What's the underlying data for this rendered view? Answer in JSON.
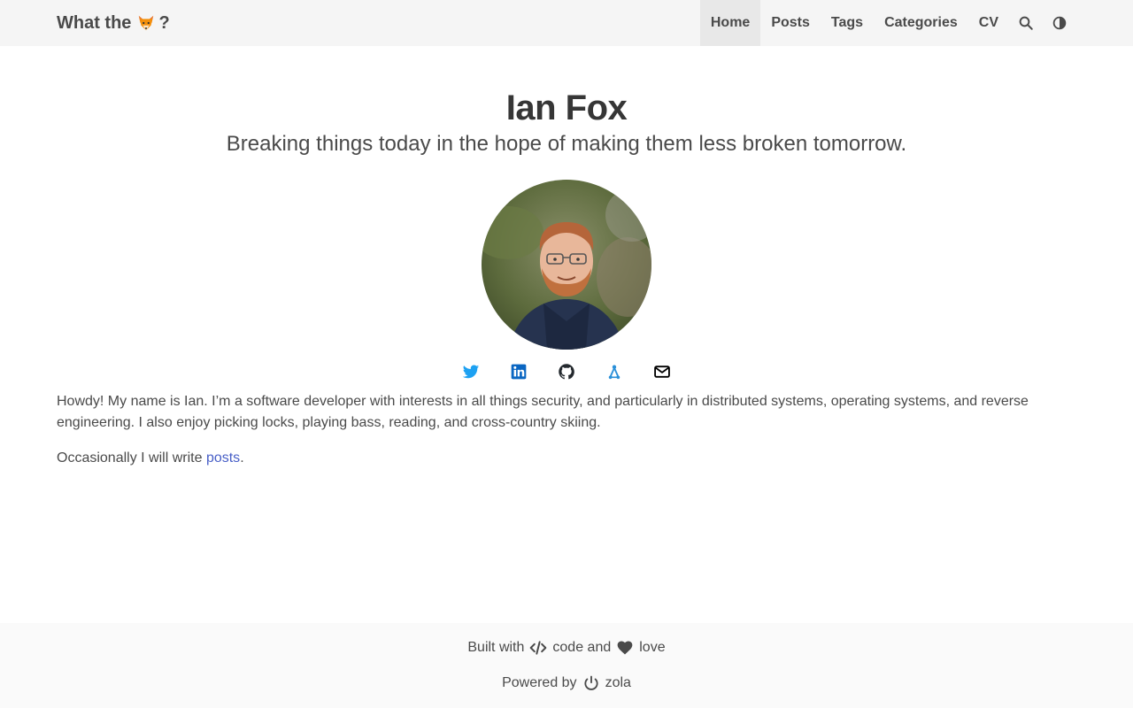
{
  "navbar": {
    "brand_prefix": "What the",
    "brand_suffix": "?",
    "items": [
      {
        "label": "Home",
        "active": true
      },
      {
        "label": "Posts",
        "active": false
      },
      {
        "label": "Tags",
        "active": false
      },
      {
        "label": "Categories",
        "active": false
      },
      {
        "label": "CV",
        "active": false
      }
    ],
    "icons": [
      "search-icon",
      "theme-toggle-icon"
    ]
  },
  "hero": {
    "title": "Ian Fox",
    "subtitle": "Breaking things today in the hope of making them less broken tomorrow."
  },
  "socials": [
    {
      "name": "twitter-icon",
      "color": "#1da1f2"
    },
    {
      "name": "linkedin-icon",
      "color": "#0a66c2"
    },
    {
      "name": "github-icon",
      "color": "#24292e"
    },
    {
      "name": "mastodon-icon",
      "color": "#2b90d9"
    },
    {
      "name": "email-icon",
      "color": "#000000"
    }
  ],
  "content": {
    "intro": "Howdy! My name is Ian. I’m a software developer with interests in all things security, and particularly in distributed systems, operating systems, and reverse engineering. I also enjoy picking locks, playing bass, reading, and cross-country skiing.",
    "occasionally_prefix": "Occasionally I will write",
    "posts_link": "posts",
    "occasionally_suffix": "."
  },
  "footer": {
    "built_with": "Built with",
    "code": "code and",
    "love": "love",
    "powered_by": "Powered by",
    "engine": "zola"
  },
  "colors": {
    "navbar_bg": "#f5f5f5",
    "link": "#485fc7",
    "text": "#4a4a4a"
  }
}
